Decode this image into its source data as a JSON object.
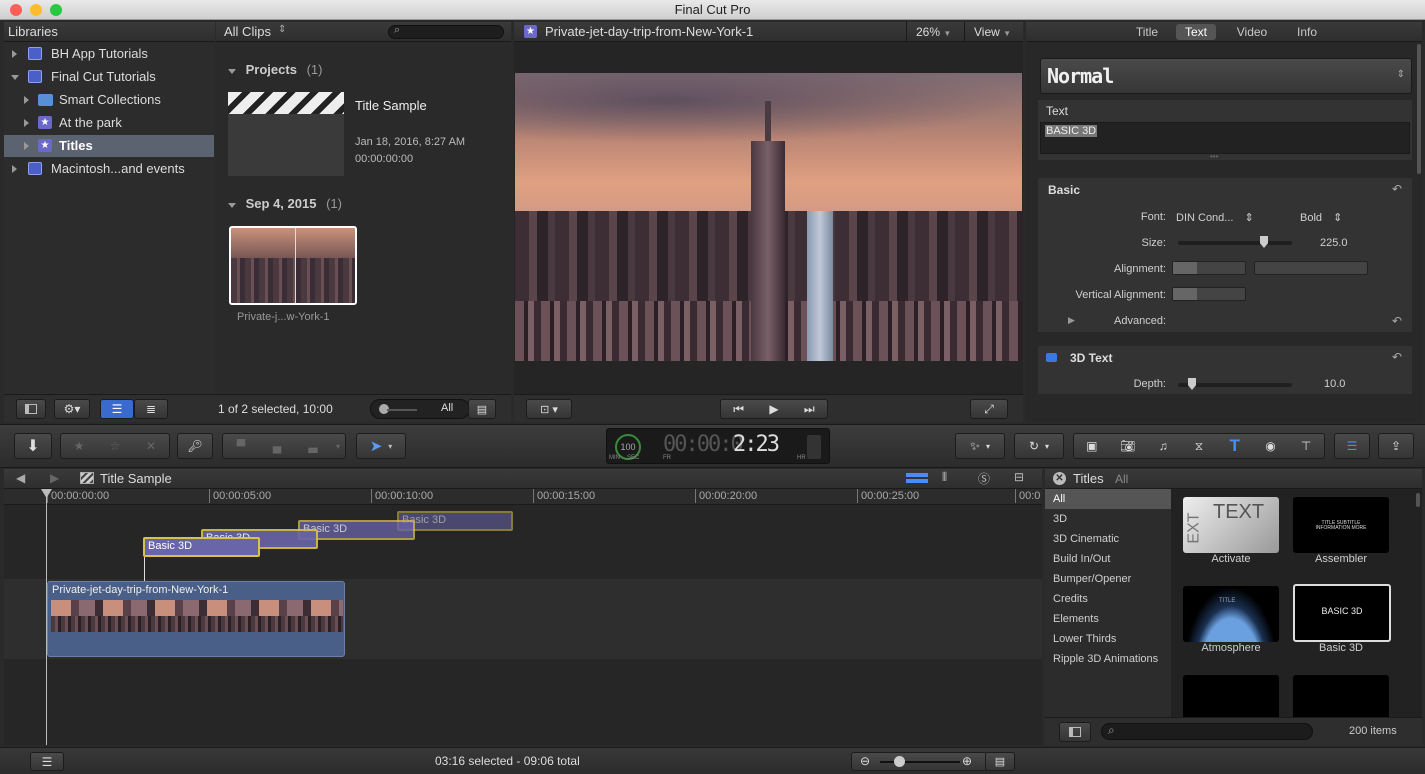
{
  "window": {
    "title": "Final Cut Pro"
  },
  "library": {
    "header": "Libraries",
    "items": [
      {
        "label": "BH App Tutorials"
      },
      {
        "label": "Final Cut Tutorials"
      },
      {
        "label": "Smart Collections"
      },
      {
        "label": "At the park"
      },
      {
        "label": "Titles"
      },
      {
        "label": "Macintosh...and events"
      }
    ]
  },
  "browser": {
    "filter": "All Clips",
    "search_placeholder": "",
    "projects_group": "Projects",
    "projects_count": "(1)",
    "project": {
      "name": "Title Sample",
      "date": "Jan 18, 2016, 8:27 AM",
      "duration": "00:00:00:00"
    },
    "date_group": "Sep 4, 2015",
    "date_count": "(1)",
    "clip_name": "Private-j...w-York-1",
    "status": "1 of 2 selected, 10:00",
    "zoom_all": "All"
  },
  "viewer": {
    "title": "Private-jet-day-trip-from-New-York-1",
    "zoom": "26%",
    "view": "View"
  },
  "inspector": {
    "tabs": [
      "Title",
      "Text",
      "Video",
      "Info"
    ],
    "active_tab": "Text",
    "preset": "Normal",
    "text_label": "Text",
    "text_value": "BASIC 3D",
    "basic": "Basic",
    "font_label": "Font:",
    "font_value": "DIN Cond...",
    "font_weight": "Bold",
    "size_label": "Size:",
    "size_value": "225.0",
    "alignment_label": "Alignment:",
    "valign_label": "Vertical Alignment:",
    "advanced_label": "Advanced:",
    "text3d": "3D Text",
    "depth_label": "Depth:",
    "depth_value": "10.0"
  },
  "toolbar": {
    "timecode": "00:00:02:23",
    "timecode_dim": "00:00:0",
    "timecode_bright": "2:23",
    "percent": "100",
    "tc_units": [
      "HR",
      "MIN",
      "SEC",
      "FR"
    ]
  },
  "timeline": {
    "project": "Title Sample",
    "ruler": [
      "00:00:00:00",
      "00:00:05:00",
      "00:00:10:00",
      "00:00:15:00",
      "00:00:20:00",
      "00:00:25:00",
      "00:0"
    ],
    "titles": [
      "Basic 3D",
      "Basic 3D",
      "Basic 3D",
      "Basic 3D"
    ],
    "clip": "Private-jet-day-trip-from-New-York-1",
    "status": "03:16 selected - 09:06 total"
  },
  "titles_browser": {
    "header": "Titles",
    "header_filter": "All",
    "categories": [
      "All",
      "3D",
      "3D Cinematic",
      "Build In/Out",
      "Bumper/Opener",
      "Credits",
      "Elements",
      "Lower Thirds",
      "Ripple 3D Animations"
    ],
    "thumbs": [
      {
        "label": "Activate",
        "art": "TEXT"
      },
      {
        "label": "Assembler",
        "art": "TITLE SUBTITLE INFORMATION MORE"
      },
      {
        "label": "Atmosphere",
        "art": "TITLE"
      },
      {
        "label": "Basic 3D",
        "art": "BASIC 3D"
      }
    ],
    "count": "200 items"
  }
}
